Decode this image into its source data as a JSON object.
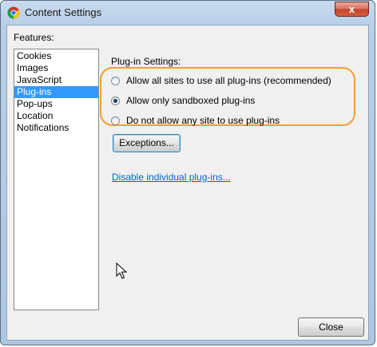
{
  "window": {
    "title": "Content Settings",
    "app_icon": "chrome-icon",
    "close_glyph": "x"
  },
  "features": {
    "label": "Features:",
    "items": [
      {
        "label": "Cookies",
        "selected": false
      },
      {
        "label": "Images",
        "selected": false
      },
      {
        "label": "JavaScript",
        "selected": false
      },
      {
        "label": "Plug-ins",
        "selected": true
      },
      {
        "label": "Pop-ups",
        "selected": false
      },
      {
        "label": "Location",
        "selected": false
      },
      {
        "label": "Notifications",
        "selected": false
      }
    ]
  },
  "plugin_settings": {
    "heading": "Plug-in Settings:",
    "options": [
      {
        "label": "Allow all sites to use all plug-ins (recommended)",
        "checked": false
      },
      {
        "label": "Allow only sandboxed plug-ins",
        "checked": true
      },
      {
        "label": "Do not allow any site to use plug-ins",
        "checked": false
      }
    ],
    "exceptions_button": "Exceptions...",
    "disable_link": "Disable individual plug-ins..."
  },
  "footer": {
    "close_button": "Close"
  },
  "colors": {
    "selection": "#3399ff",
    "highlight_outline": "#f0a030",
    "link": "#0066cc"
  }
}
